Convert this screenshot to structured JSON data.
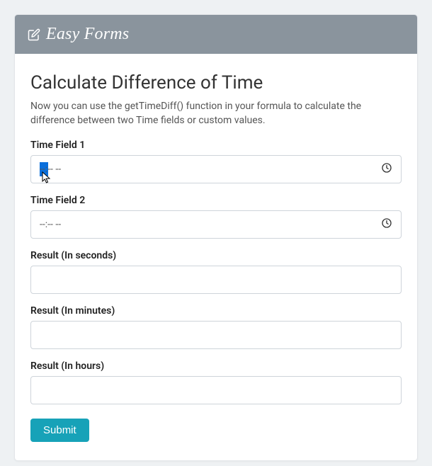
{
  "brand": "Easy Forms",
  "title": "Calculate Difference of Time",
  "description": "Now you can use the getTimeDiff() function in your formula to calculate the difference between two Time fields or custom values.",
  "fields": {
    "time1": {
      "label": "Time Field 1",
      "value": "--:-- --"
    },
    "time2": {
      "label": "Time Field 2",
      "value": "--:-- --"
    },
    "result_seconds": {
      "label": "Result (In seconds)",
      "value": ""
    },
    "result_minutes": {
      "label": "Result (In minutes)",
      "value": ""
    },
    "result_hours": {
      "label": "Result (In hours)",
      "value": ""
    }
  },
  "submit_label": "Submit",
  "colors": {
    "header_bg": "#8a949d",
    "submit_bg": "#17a2b8",
    "selection": "#0a6fdc"
  }
}
